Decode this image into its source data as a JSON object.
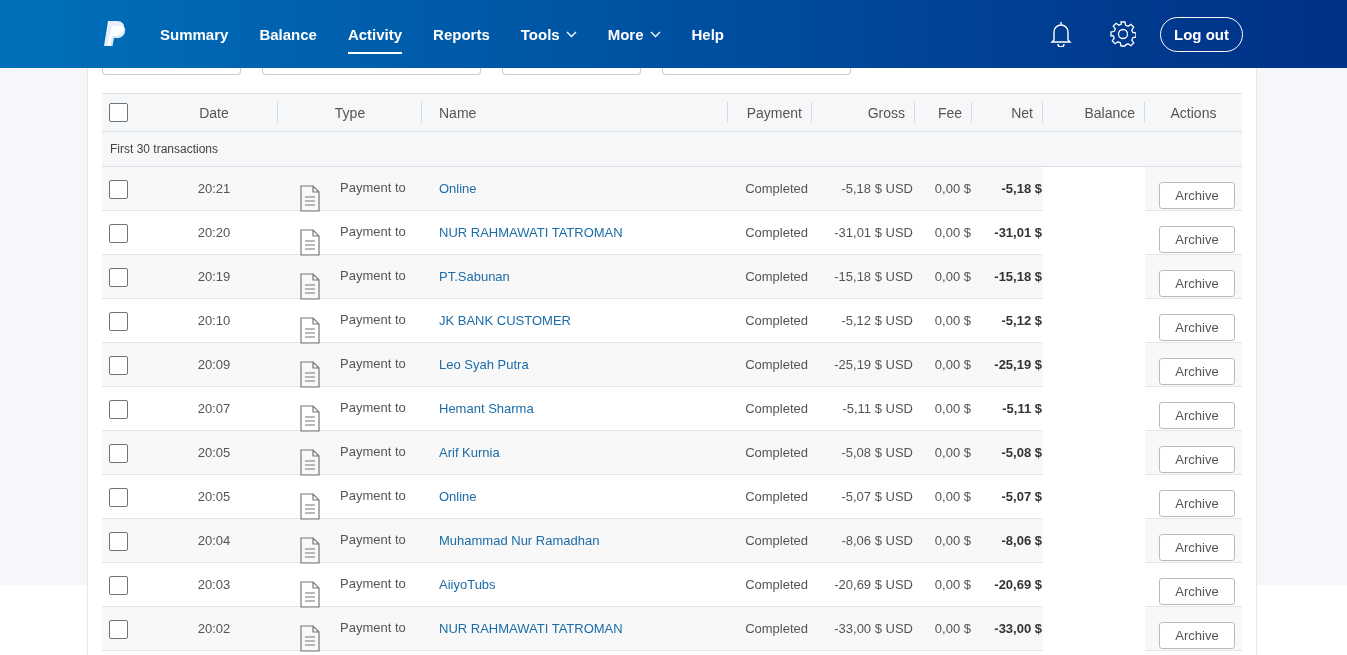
{
  "nav": {
    "items": [
      {
        "label": "Summary",
        "selected": false,
        "dropdown": false
      },
      {
        "label": "Balance",
        "selected": false,
        "dropdown": false
      },
      {
        "label": "Activity",
        "selected": true,
        "dropdown": false
      },
      {
        "label": "Reports",
        "selected": false,
        "dropdown": false
      },
      {
        "label": "Tools",
        "selected": false,
        "dropdown": true
      },
      {
        "label": "More",
        "selected": false,
        "dropdown": true
      },
      {
        "label": "Help",
        "selected": false,
        "dropdown": false
      }
    ],
    "logout": "Log out"
  },
  "table": {
    "select_all": {
      "checked": false
    },
    "columns": [
      "Date",
      "Type",
      "Name",
      "Payment",
      "Gross",
      "Fee",
      "Net",
      "Balance",
      "Actions"
    ],
    "group_label": "First 30 transactions",
    "rows": [
      {
        "checked": false,
        "time": "20:21",
        "type": "Payment to",
        "name": "Online",
        "payment": "Completed",
        "gross": "-5,18 $ USD",
        "fee": "0,00 $",
        "net": "-5,18 $",
        "action": "Archive"
      },
      {
        "checked": false,
        "time": "20:20",
        "type": "Payment to",
        "name": "NUR RAHMAWATI TATROMAN",
        "payment": "Completed",
        "gross": "-31,01 $ USD",
        "fee": "0,00 $",
        "net": "-31,01 $",
        "action": "Archive"
      },
      {
        "checked": false,
        "time": "20:19",
        "type": "Payment to",
        "name": "PT.Sabunan",
        "payment": "Completed",
        "gross": "-15,18 $ USD",
        "fee": "0,00 $",
        "net": "-15,18 $",
        "action": "Archive"
      },
      {
        "checked": false,
        "time": "20:10",
        "type": "Payment to",
        "name": "JK BANK CUSTOMER",
        "payment": "Completed",
        "gross": "-5,12 $ USD",
        "fee": "0,00 $",
        "net": "-5,12 $",
        "action": "Archive"
      },
      {
        "checked": false,
        "time": "20:09",
        "type": "Payment to",
        "name": "Leo Syah Putra",
        "payment": "Completed",
        "gross": "-25,19 $ USD",
        "fee": "0,00 $",
        "net": "-25,19 $",
        "action": "Archive"
      },
      {
        "checked": false,
        "time": "20:07",
        "type": "Payment to",
        "name": "Hemant Sharma",
        "payment": "Completed",
        "gross": "-5,11 $ USD",
        "fee": "0,00 $",
        "net": "-5,11 $",
        "action": "Archive"
      },
      {
        "checked": false,
        "time": "20:05",
        "type": "Payment to",
        "name": "Arif Kurnia",
        "payment": "Completed",
        "gross": "-5,08 $ USD",
        "fee": "0,00 $",
        "net": "-5,08 $",
        "action": "Archive"
      },
      {
        "checked": false,
        "time": "20:05",
        "type": "Payment to",
        "name": "Online",
        "payment": "Completed",
        "gross": "-5,07 $ USD",
        "fee": "0,00 $",
        "net": "-5,07 $",
        "action": "Archive"
      },
      {
        "checked": false,
        "time": "20:04",
        "type": "Payment to",
        "name": "Muhammad Nur Ramadhan",
        "payment": "Completed",
        "gross": "-8,06 $ USD",
        "fee": "0,00 $",
        "net": "-8,06 $",
        "action": "Archive"
      },
      {
        "checked": false,
        "time": "20:03",
        "type": "Payment to",
        "name": "AiiyoTubs",
        "payment": "Completed",
        "gross": "-20,69 $ USD",
        "fee": "0,00 $",
        "net": "-20,69 $",
        "action": "Archive"
      },
      {
        "checked": false,
        "time": "20:02",
        "type": "Payment to",
        "name": "NUR RAHMAWATI TATROMAN",
        "payment": "Completed",
        "gross": "-33,00 $ USD",
        "fee": "0,00 $",
        "net": "-33,00 $",
        "action": "Archive"
      }
    ]
  }
}
